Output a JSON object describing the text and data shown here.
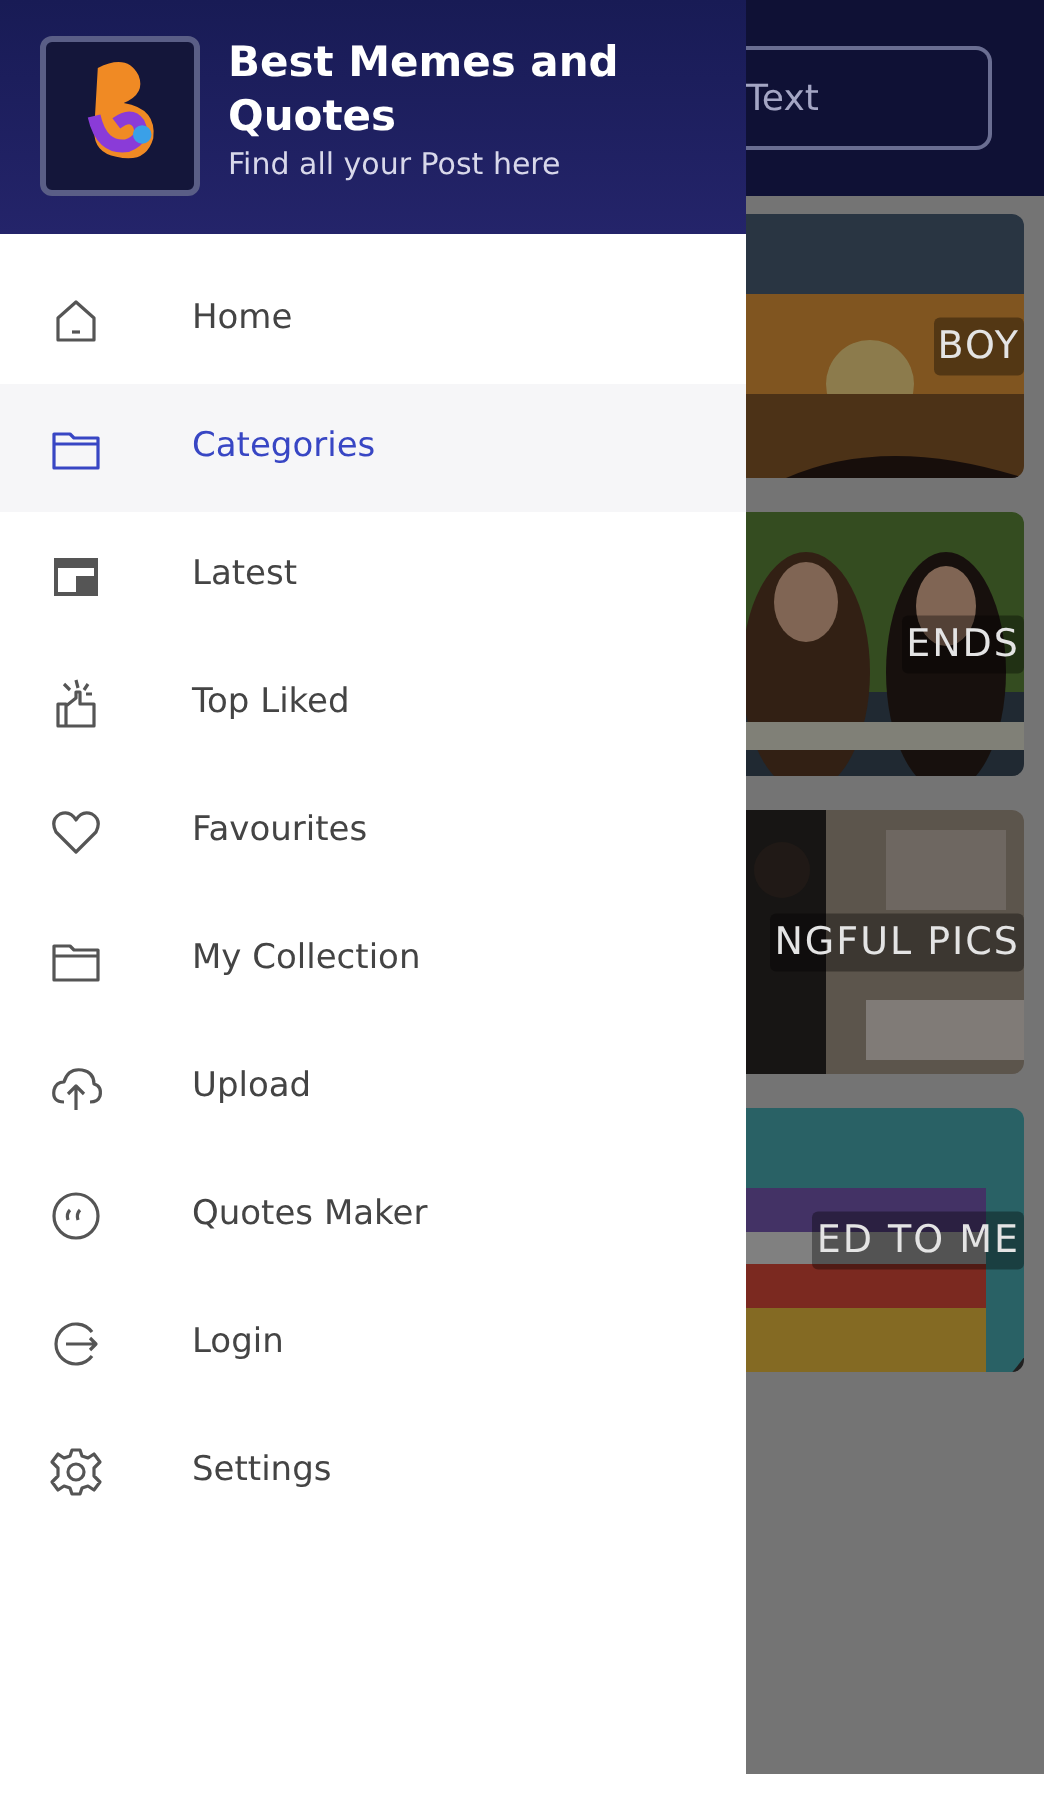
{
  "app": {
    "header_button": "Text",
    "cards": [
      {
        "label": "BOY",
        "kind": "sunset"
      },
      {
        "label": "ENDS",
        "kind": "friends"
      },
      {
        "label": "NGFUL PICS",
        "kind": "room"
      },
      {
        "label": "ED TO ME",
        "kind": "rainbow"
      }
    ]
  },
  "drawer": {
    "title": "Best Memes and Quotes",
    "subtitle": "Find all your Post here",
    "items": [
      {
        "label": "Home",
        "kind": "home",
        "selected": false
      },
      {
        "label": "Categories",
        "kind": "folder",
        "selected": true
      },
      {
        "label": "Latest",
        "kind": "calendar",
        "selected": false
      },
      {
        "label": "Top Liked",
        "kind": "like",
        "selected": false
      },
      {
        "label": "Favourites",
        "kind": "heart",
        "selected": false
      },
      {
        "label": "My Collection",
        "kind": "folder",
        "selected": false
      },
      {
        "label": "Upload",
        "kind": "upload",
        "selected": false
      },
      {
        "label": "Quotes Maker",
        "kind": "quote",
        "selected": false
      },
      {
        "label": "Login",
        "kind": "login",
        "selected": false
      },
      {
        "label": "Settings",
        "kind": "gear",
        "selected": false
      }
    ]
  }
}
